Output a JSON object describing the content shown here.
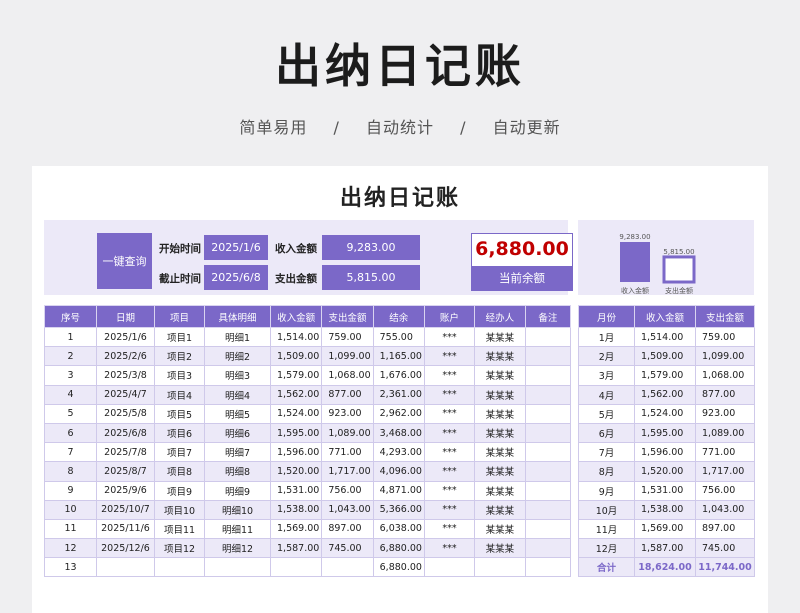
{
  "header": {
    "title": "出纳日记账",
    "subtitle_parts": [
      "简单易用",
      "/",
      "自动统计",
      "/",
      "自动更新"
    ]
  },
  "sheet": {
    "title": "出纳日记账",
    "query_button": "一键查询",
    "start_label": "开始时间",
    "start_value": "2025/1/6",
    "end_label": "截止时间",
    "end_value": "2025/6/8",
    "income_label": "收入金额",
    "income_value": "9,283.00",
    "expense_label": "支出金额",
    "expense_value": "5,815.00",
    "balance_value": "6,880.00",
    "balance_label": "当前余额"
  },
  "colors": {
    "accent": "#7b68c8",
    "band": "#ece9f8",
    "balance": "#c00000"
  },
  "chart_data": {
    "type": "bar",
    "categories": [
      "收入金额",
      "支出金额"
    ],
    "values": [
      9283,
      5815
    ],
    "value_labels": [
      "9,283.00",
      "5,815.00"
    ]
  },
  "ledger": {
    "headers": [
      "序号",
      "日期",
      "项目",
      "具体明细",
      "收入金额",
      "支出金额",
      "结余",
      "账户",
      "经办人",
      "备注"
    ],
    "rows": [
      [
        "1",
        "2025/1/6",
        "项目1",
        "明细1",
        "1,514.00",
        "759.00",
        "755.00",
        "***",
        "某某某",
        ""
      ],
      [
        "2",
        "2025/2/6",
        "项目2",
        "明细2",
        "1,509.00",
        "1,099.00",
        "1,165.00",
        "***",
        "某某某",
        ""
      ],
      [
        "3",
        "2025/3/8",
        "项目3",
        "明细3",
        "1,579.00",
        "1,068.00",
        "1,676.00",
        "***",
        "某某某",
        ""
      ],
      [
        "4",
        "2025/4/7",
        "项目4",
        "明细4",
        "1,562.00",
        "877.00",
        "2,361.00",
        "***",
        "某某某",
        ""
      ],
      [
        "5",
        "2025/5/8",
        "项目5",
        "明细5",
        "1,524.00",
        "923.00",
        "2,962.00",
        "***",
        "某某某",
        ""
      ],
      [
        "6",
        "2025/6/8",
        "项目6",
        "明细6",
        "1,595.00",
        "1,089.00",
        "3,468.00",
        "***",
        "某某某",
        ""
      ],
      [
        "7",
        "2025/7/8",
        "项目7",
        "明细7",
        "1,596.00",
        "771.00",
        "4,293.00",
        "***",
        "某某某",
        ""
      ],
      [
        "8",
        "2025/8/7",
        "项目8",
        "明细8",
        "1,520.00",
        "1,717.00",
        "4,096.00",
        "***",
        "某某某",
        ""
      ],
      [
        "9",
        "2025/9/6",
        "项目9",
        "明细9",
        "1,531.00",
        "756.00",
        "4,871.00",
        "***",
        "某某某",
        ""
      ],
      [
        "10",
        "2025/10/7",
        "项目10",
        "明细10",
        "1,538.00",
        "1,043.00",
        "5,366.00",
        "***",
        "某某某",
        ""
      ],
      [
        "11",
        "2025/11/6",
        "项目11",
        "明细11",
        "1,569.00",
        "897.00",
        "6,038.00",
        "***",
        "某某某",
        ""
      ],
      [
        "12",
        "2025/12/6",
        "项目12",
        "明细12",
        "1,587.00",
        "745.00",
        "6,880.00",
        "***",
        "某某某",
        ""
      ],
      [
        "13",
        "",
        "",
        "",
        "",
        "",
        "6,880.00",
        "",
        "",
        ""
      ]
    ]
  },
  "monthly": {
    "headers": [
      "月份",
      "收入金额",
      "支出金额"
    ],
    "rows": [
      [
        "1月",
        "1,514.00",
        "759.00"
      ],
      [
        "2月",
        "1,509.00",
        "1,099.00"
      ],
      [
        "3月",
        "1,579.00",
        "1,068.00"
      ],
      [
        "4月",
        "1,562.00",
        "877.00"
      ],
      [
        "5月",
        "1,524.00",
        "923.00"
      ],
      [
        "6月",
        "1,595.00",
        "1,089.00"
      ],
      [
        "7月",
        "1,596.00",
        "771.00"
      ],
      [
        "8月",
        "1,520.00",
        "1,717.00"
      ],
      [
        "9月",
        "1,531.00",
        "756.00"
      ],
      [
        "10月",
        "1,538.00",
        "1,043.00"
      ],
      [
        "11月",
        "1,569.00",
        "897.00"
      ],
      [
        "12月",
        "1,587.00",
        "745.00"
      ]
    ],
    "total": [
      "合计",
      "18,624.00",
      "11,744.00"
    ]
  }
}
